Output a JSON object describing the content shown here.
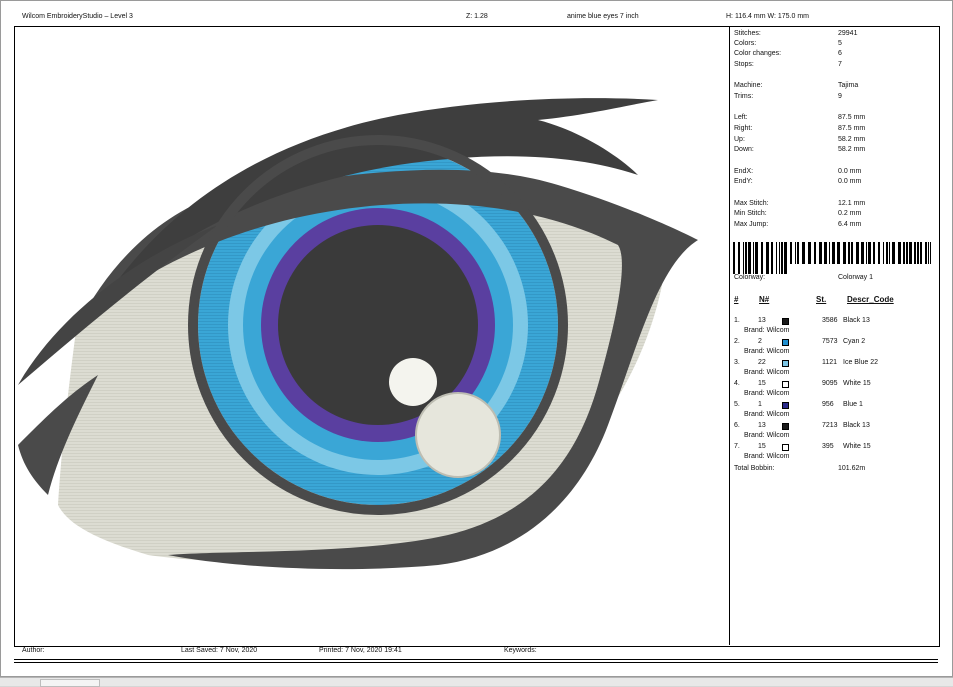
{
  "header": {
    "app_title": "Wilcom EmbroideryStudio – Level 3",
    "zoom": "Z: 1.28",
    "design_name": "anime blue eyes 7 inch",
    "size": "H: 116.4 mm   W: 175.0 mm"
  },
  "footer": {
    "author": "Author:",
    "last_saved": "Last Saved:  7 Nov, 2020",
    "printed": "Printed:  7 Nov, 2020 19:41",
    "keywords": "Keywords:"
  },
  "stats": [
    {
      "label": "Stitches:",
      "value": "29941"
    },
    {
      "label": "Colors:",
      "value": "5"
    },
    {
      "label": "Color changes:",
      "value": "6"
    },
    {
      "label": "Stops:",
      "value": "7"
    },
    {
      "label": "Machine:",
      "value": "Tajima"
    },
    {
      "label": "Trims:",
      "value": "9"
    },
    {
      "label": "Left:",
      "value": "87.5 mm"
    },
    {
      "label": "Right:",
      "value": "87.5 mm"
    },
    {
      "label": "Up:",
      "value": "58.2 mm"
    },
    {
      "label": "Down:",
      "value": "58.2 mm"
    },
    {
      "label": "EndX:",
      "value": "0.0 mm"
    },
    {
      "label": "EndY:",
      "value": "0.0 mm"
    },
    {
      "label": "Max Stitch:",
      "value": "12.1 mm"
    },
    {
      "label": "Min Stitch:",
      "value": "0.2 mm"
    },
    {
      "label": "Max Jump:",
      "value": "6.4 mm"
    }
  ],
  "colorway": {
    "label": "Colorway:",
    "value": "Colorway 1"
  },
  "table_headers": {
    "idx": "#",
    "n": "N#",
    "st": "St.",
    "desc": "Descr_Code"
  },
  "color_rows": [
    {
      "idx": "1.",
      "n": "13",
      "color": "#1a1a1a",
      "st": "3586",
      "desc": "Black 13",
      "brand": "Brand: Wilcom"
    },
    {
      "idx": "2.",
      "n": "2",
      "color": "#1f8fd0",
      "st": "7573",
      "desc": "Cyan 2",
      "brand": "Brand: Wilcom"
    },
    {
      "idx": "3.",
      "n": "22",
      "color": "#7cc6e6",
      "st": "1121",
      "desc": "Ice Blue 22",
      "brand": "Brand: Wilcom"
    },
    {
      "idx": "4.",
      "n": "15",
      "color": "#ffffff",
      "st": "9095",
      "desc": "White 15",
      "brand": "Brand: Wilcom"
    },
    {
      "idx": "5.",
      "n": "1",
      "color": "#2a2a8a",
      "st": "956",
      "desc": "Blue 1",
      "brand": "Brand: Wilcom"
    },
    {
      "idx": "6.",
      "n": "13",
      "color": "#1a1a1a",
      "st": "7213",
      "desc": "Black 13",
      "brand": "Brand: Wilcom"
    },
    {
      "idx": "7.",
      "n": "15",
      "color": "#ffffff",
      "st": "395",
      "desc": "White 15",
      "brand": "Brand: Wilcom"
    }
  ],
  "total_bobbin": {
    "label": "Total Bobbin:",
    "value": "101.62m"
  },
  "colors": {
    "outline": "#4a4a4a",
    "sclera": "#dcdcd2",
    "iris_outer": "#3aa6d6",
    "iris_inner": "#7cc8e6",
    "pupil_ring": "#5a3fa0",
    "pupil": "#3a3a3a",
    "highlight": "#f4f4ee"
  }
}
